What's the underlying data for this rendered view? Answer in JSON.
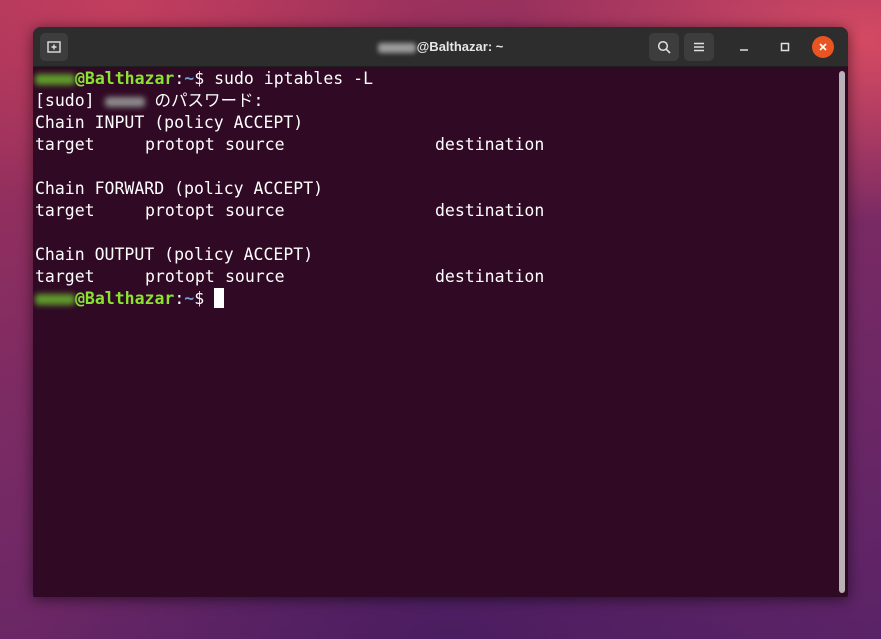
{
  "window": {
    "title_host": "@Balthazar: ~"
  },
  "terminal": {
    "prompt_host": "@Balthazar",
    "prompt_sep": ":",
    "prompt_path": "~",
    "prompt_dollar": "$ ",
    "command": "sudo iptables -L",
    "sudo_prefix": "[sudo] ",
    "sudo_suffix": " のパスワード:",
    "chains": [
      {
        "header": "Chain INPUT (policy ACCEPT)",
        "columns": [
          "target",
          "prot",
          "opt",
          "source",
          "destination"
        ]
      },
      {
        "header": "Chain FORWARD (policy ACCEPT)",
        "columns": [
          "target",
          "prot",
          "opt",
          "source",
          "destination"
        ]
      },
      {
        "header": "Chain OUTPUT (policy ACCEPT)",
        "columns": [
          "target",
          "prot",
          "opt",
          "source",
          "destination"
        ]
      }
    ]
  },
  "icons": {
    "new_tab": "new-tab-icon",
    "search": "search-icon",
    "menu": "hamburger-menu-icon",
    "minimize": "minimize-icon",
    "maximize": "maximize-icon",
    "close": "close-icon"
  },
  "colors": {
    "terminal_bg": "#300a24",
    "user_green": "#8ae234",
    "path_blue": "#729fcf",
    "close_orange": "#e95420"
  }
}
